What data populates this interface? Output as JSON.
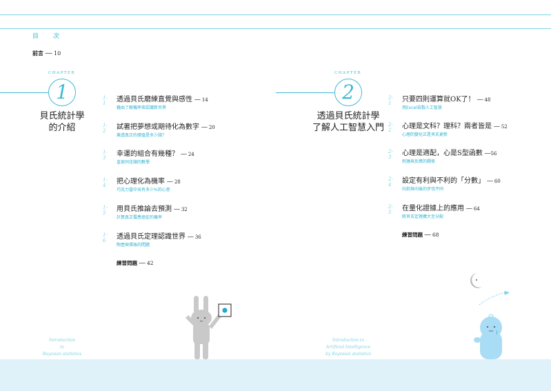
{
  "toc_heading": "目　次",
  "preface": {
    "label": "前言",
    "page": "── 10"
  },
  "chapter_label": "CHAPTER",
  "chapters": [
    {
      "number": "1",
      "title_lines": [
        "貝氏統計學",
        "的介紹"
      ],
      "english_lines": [
        "Introduction",
        "to",
        "Bayesian statistics"
      ],
      "items": [
        {
          "num": "1-1",
          "title": "透過貝氏磨練直覺與感性",
          "page": "── 14",
          "sub": "藉由了解機率來認識新世界"
        },
        {
          "num": "1-2",
          "title": "試著把夢想或期待化為數字",
          "page": "── 20",
          "sub": "樂透真正的價值是多少錢？"
        },
        {
          "num": "1-3",
          "title": "幸運的組合有幾種？",
          "page": "── 24",
          "sub": "皇家同花順的數學"
        },
        {
          "num": "1-4",
          "title": "把心理化為機率",
          "page": "── 28",
          "sub": "巧克力當中含有多少%的心意"
        },
        {
          "num": "1-5",
          "title": "用貝氏推論去預測",
          "page": "── 32",
          "sub": "計算真正罹患癌症的機率"
        },
        {
          "num": "1-6",
          "title": "透過貝氏定理認識世界",
          "page": "── 36",
          "sub": "陶壺與彈珠的問題"
        }
      ],
      "practice": {
        "label": "練習問題",
        "page": "── 42"
      }
    },
    {
      "number": "2",
      "title_lines": [
        "透過貝氏統計學",
        "了解人工智慧入門"
      ],
      "english_lines": [
        "Introduction to",
        "Artificial Intelligence",
        "by Bayesian statistics"
      ],
      "items": [
        {
          "num": "2-1",
          "title": "只要四則運算就OK了！",
          "page": "── 48",
          "sub": "用Excel自製人工智慧"
        },
        {
          "num": "2-2",
          "title": "心理是文科？理科？兩者皆是",
          "page": "── 52",
          "sub": "心理的變化正是貝氏更新"
        },
        {
          "num": "2-3",
          "title": "心理是適配，心是S型函數",
          "page": "──56",
          "sub": "刺激與反應的關係"
        },
        {
          "num": "2-4",
          "title": "設定有利與不利的「分數」",
          "page": "── 60",
          "sub": "向前與向後的步伐不同"
        },
        {
          "num": "2-5",
          "title": "在量化證據上的應用",
          "page": "── 64",
          "sub": "將貝氏定理擴大至分配"
        }
      ],
      "practice": {
        "label": "練習問題",
        "page": "── 68"
      }
    }
  ],
  "colors": {
    "accent": "#3fb8d4",
    "light_accent": "#7fd3e3",
    "footer": "#dff2fa",
    "character_blue": "#a9dcf5",
    "rabbit_gray": "#c9c9c9"
  }
}
